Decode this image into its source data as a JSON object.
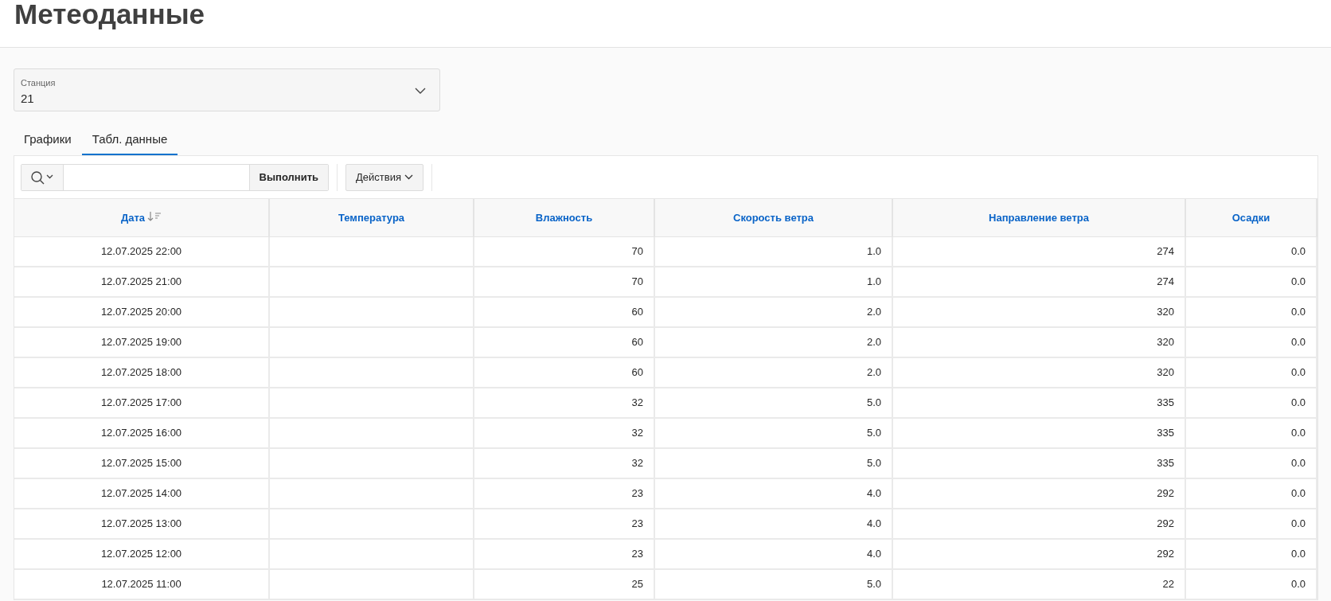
{
  "page_title": "Метеоданные",
  "station_select": {
    "label": "Станция",
    "value": "21"
  },
  "tabs": [
    {
      "label": "Графики",
      "selected": false
    },
    {
      "label": "Табл. данные",
      "selected": true
    }
  ],
  "toolbar": {
    "go_button": "Выполнить",
    "actions_button": "Действия"
  },
  "table": {
    "columns": [
      {
        "label": "Дата",
        "sorted": true
      },
      {
        "label": "Температура",
        "sorted": false
      },
      {
        "label": "Влажность",
        "sorted": false
      },
      {
        "label": "Скорость ветра",
        "sorted": false
      },
      {
        "label": "Направление ветра",
        "sorted": false
      },
      {
        "label": "Осадки",
        "sorted": false
      }
    ],
    "rows": [
      [
        "12.07.2025 22:00",
        "",
        "70",
        "1.0",
        "274",
        "0.0"
      ],
      [
        "12.07.2025 21:00",
        "",
        "70",
        "1.0",
        "274",
        "0.0"
      ],
      [
        "12.07.2025 20:00",
        "",
        "60",
        "2.0",
        "320",
        "0.0"
      ],
      [
        "12.07.2025 19:00",
        "",
        "60",
        "2.0",
        "320",
        "0.0"
      ],
      [
        "12.07.2025 18:00",
        "",
        "60",
        "2.0",
        "320",
        "0.0"
      ],
      [
        "12.07.2025 17:00",
        "",
        "32",
        "5.0",
        "335",
        "0.0"
      ],
      [
        "12.07.2025 16:00",
        "",
        "32",
        "5.0",
        "335",
        "0.0"
      ],
      [
        "12.07.2025 15:00",
        "",
        "32",
        "5.0",
        "335",
        "0.0"
      ],
      [
        "12.07.2025 14:00",
        "",
        "23",
        "4.0",
        "292",
        "0.0"
      ],
      [
        "12.07.2025 13:00",
        "",
        "23",
        "4.0",
        "292",
        "0.0"
      ],
      [
        "12.07.2025 12:00",
        "",
        "23",
        "4.0",
        "292",
        "0.0"
      ],
      [
        "12.07.2025 11:00",
        "",
        "25",
        "5.0",
        "22",
        "0.0"
      ]
    ]
  }
}
